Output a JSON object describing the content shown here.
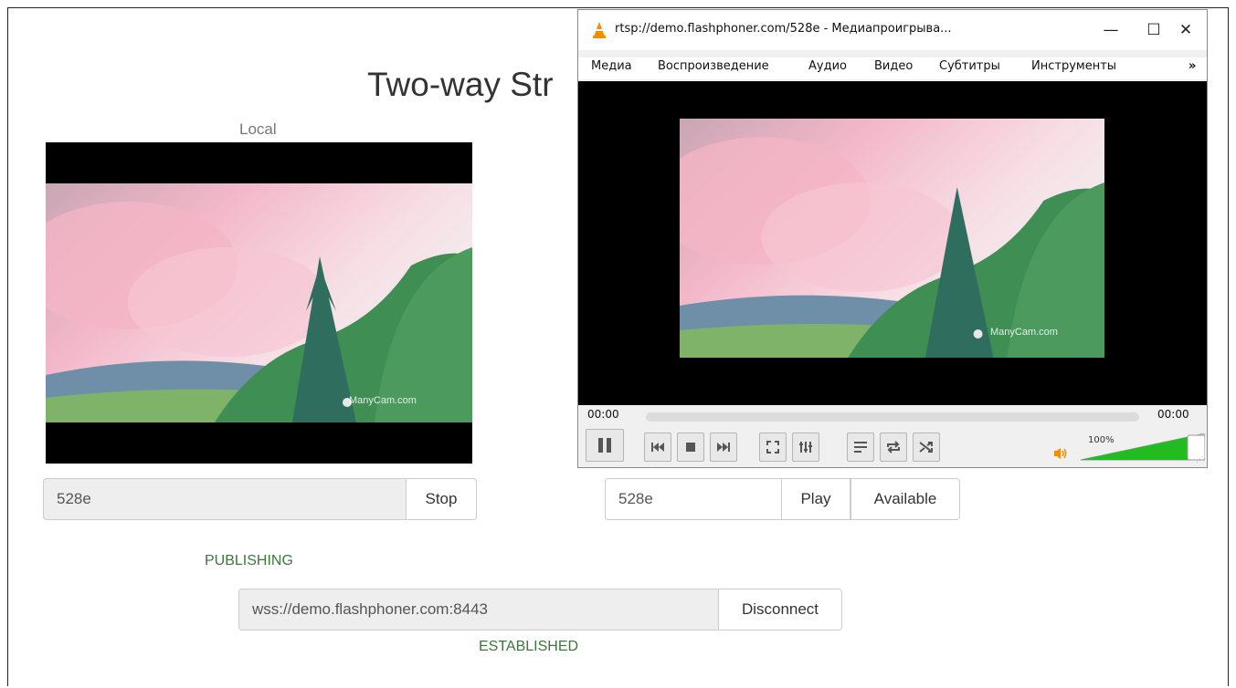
{
  "page": {
    "title": "Two-way Str",
    "local_label": "Local"
  },
  "local_video": {
    "watermark": "ManyCam.com"
  },
  "publish": {
    "stream_name": "528e",
    "stop_label": "Stop",
    "status": "PUBLISHING"
  },
  "play": {
    "stream_name": "528e",
    "play_label": "Play",
    "available_label": "Available"
  },
  "connection": {
    "url": "wss://demo.flashphoner.com:8443",
    "disconnect_label": "Disconnect",
    "status": "ESTABLISHED"
  },
  "vlc": {
    "title": "rtsp://demo.flashphoner.com/528e - Медиапроигрыва...",
    "minimize_glyph": "—",
    "maximize_glyph": "☐",
    "close_glyph": "✕",
    "menu": [
      "Медиа",
      "Воспроизведение",
      "Аудио",
      "Видео",
      "Субтитры",
      "Инструменты",
      "»"
    ],
    "time_elapsed": "00:00",
    "time_total": "00:00",
    "progress_fraction": 0,
    "volume_label": "100%",
    "volume_fraction": 1.0,
    "watermark": "ManyCam.com",
    "colors": {
      "volume_fill": "#22bb22",
      "cone_orange": "#f28c00"
    }
  },
  "status_color": "#3c763d"
}
